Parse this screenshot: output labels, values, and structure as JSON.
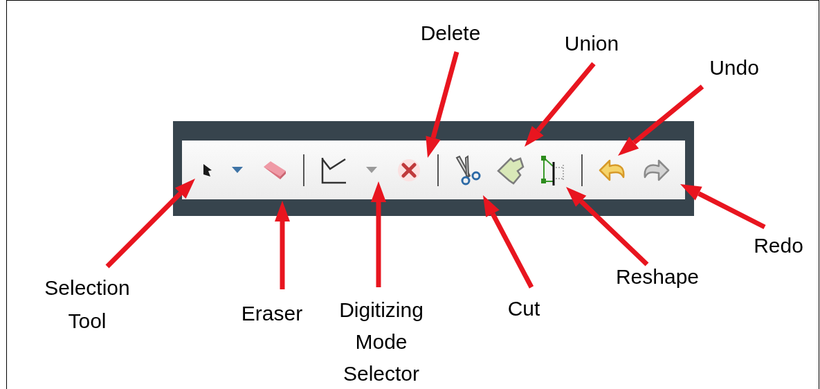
{
  "toolbar": {
    "tools": [
      {
        "kind": "pointer"
      },
      {
        "kind": "dropdown",
        "disabled": false
      },
      {
        "kind": "eraser"
      },
      {
        "kind": "separator"
      },
      {
        "kind": "digitize"
      },
      {
        "kind": "dropdown",
        "disabled": true
      },
      {
        "kind": "delete"
      },
      {
        "kind": "separator"
      },
      {
        "kind": "cut"
      },
      {
        "kind": "union"
      },
      {
        "kind": "reshape"
      },
      {
        "kind": "separator"
      },
      {
        "kind": "undo",
        "disabled": false
      },
      {
        "kind": "redo",
        "disabled": true
      }
    ]
  },
  "callouts": [
    {
      "label": "Delete"
    },
    {
      "label": "Union"
    },
    {
      "label": "Undo"
    },
    {
      "label": "Redo"
    },
    {
      "label": "Reshape"
    },
    {
      "label": "Selection Tool"
    },
    {
      "label": "Eraser"
    },
    {
      "label": "Digitizing Mode Selector"
    },
    {
      "label": "Cut"
    }
  ]
}
